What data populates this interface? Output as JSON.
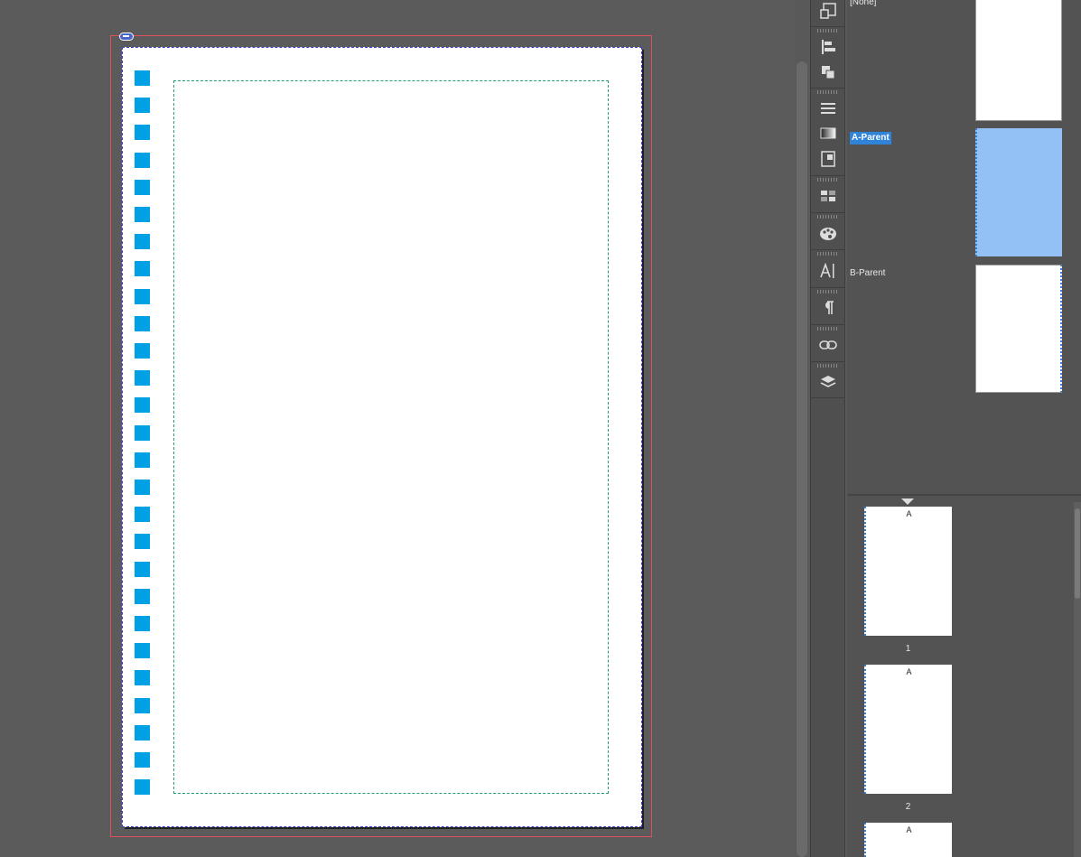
{
  "parents_panel": {
    "items": [
      {
        "label": "[None]"
      },
      {
        "label": "A-Parent"
      },
      {
        "label": "B-Parent"
      }
    ]
  },
  "pages_panel": {
    "pages": [
      {
        "parent_letter": "A",
        "number": "1"
      },
      {
        "parent_letter": "A",
        "number": "2"
      },
      {
        "parent_letter": "A",
        "number": ""
      }
    ]
  },
  "colors": {
    "selection": "#2f83d9",
    "selected_thumb": "#94c1f5",
    "swatch_squares": "#00a0e4",
    "bleed_guide": "#e0505c",
    "margin_guide": "#2a9a7a"
  },
  "tool_strip": {
    "icons": [
      "transform-icon",
      "align-icon",
      "pathfinder-icon",
      "stroke-icon",
      "gradient-icon",
      "text-wrap-icon",
      "swatches-icon",
      "color-icon",
      "character-styles-icon",
      "paragraph-icon",
      "links-icon",
      "layers-icon"
    ]
  }
}
